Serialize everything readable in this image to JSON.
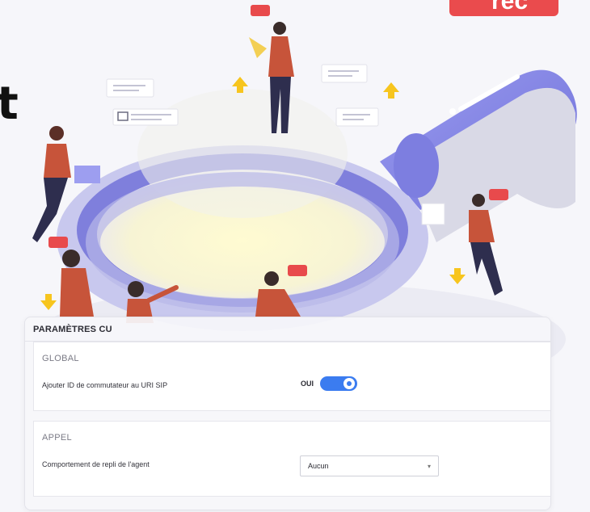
{
  "backdrop": {
    "partial_heading": "t",
    "tag_text": "rec"
  },
  "panel": {
    "title": "PARAMÈTRES CU",
    "sections": {
      "global": {
        "title": "GLOBAL",
        "rows": [
          {
            "label": "Ajouter ID de commutateur au URI SIP",
            "control": "toggle",
            "state_label": "OUI",
            "on": true
          }
        ]
      },
      "appel": {
        "title": "APPEL",
        "rows": [
          {
            "label": "Comportement de repli de l'agent",
            "control": "select",
            "selected": "Aucun"
          }
        ]
      }
    }
  },
  "colors": {
    "accent": "#3b7cf0",
    "brand_red": "#ea4b4d",
    "lens_purple": "#8f8ee8"
  },
  "icons": [
    "chevron-down-icon",
    "chat-bubble-icon",
    "up-arrow-icon",
    "down-arrow-icon",
    "magnifier-illustration"
  ]
}
